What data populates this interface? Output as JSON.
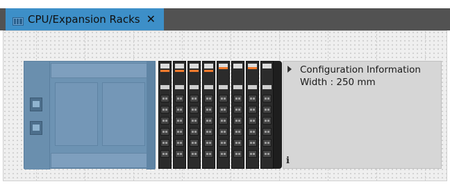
{
  "tab": {
    "title": "CPU/Expansion Racks",
    "close_glyph": "✕",
    "icon": "rack-icon"
  },
  "info_panel": {
    "title": "Configuration Information",
    "width_text": "Width : 250 mm",
    "info_glyph": "i"
  },
  "colors": {
    "tab_active": "#3d8fc8",
    "tab_bar": "#525252",
    "cpu_unit": "#6d93b3",
    "io_stripe": "#f07a2c",
    "io_body": "#2b2b2b",
    "info_bg": "#d6d6d6"
  }
}
